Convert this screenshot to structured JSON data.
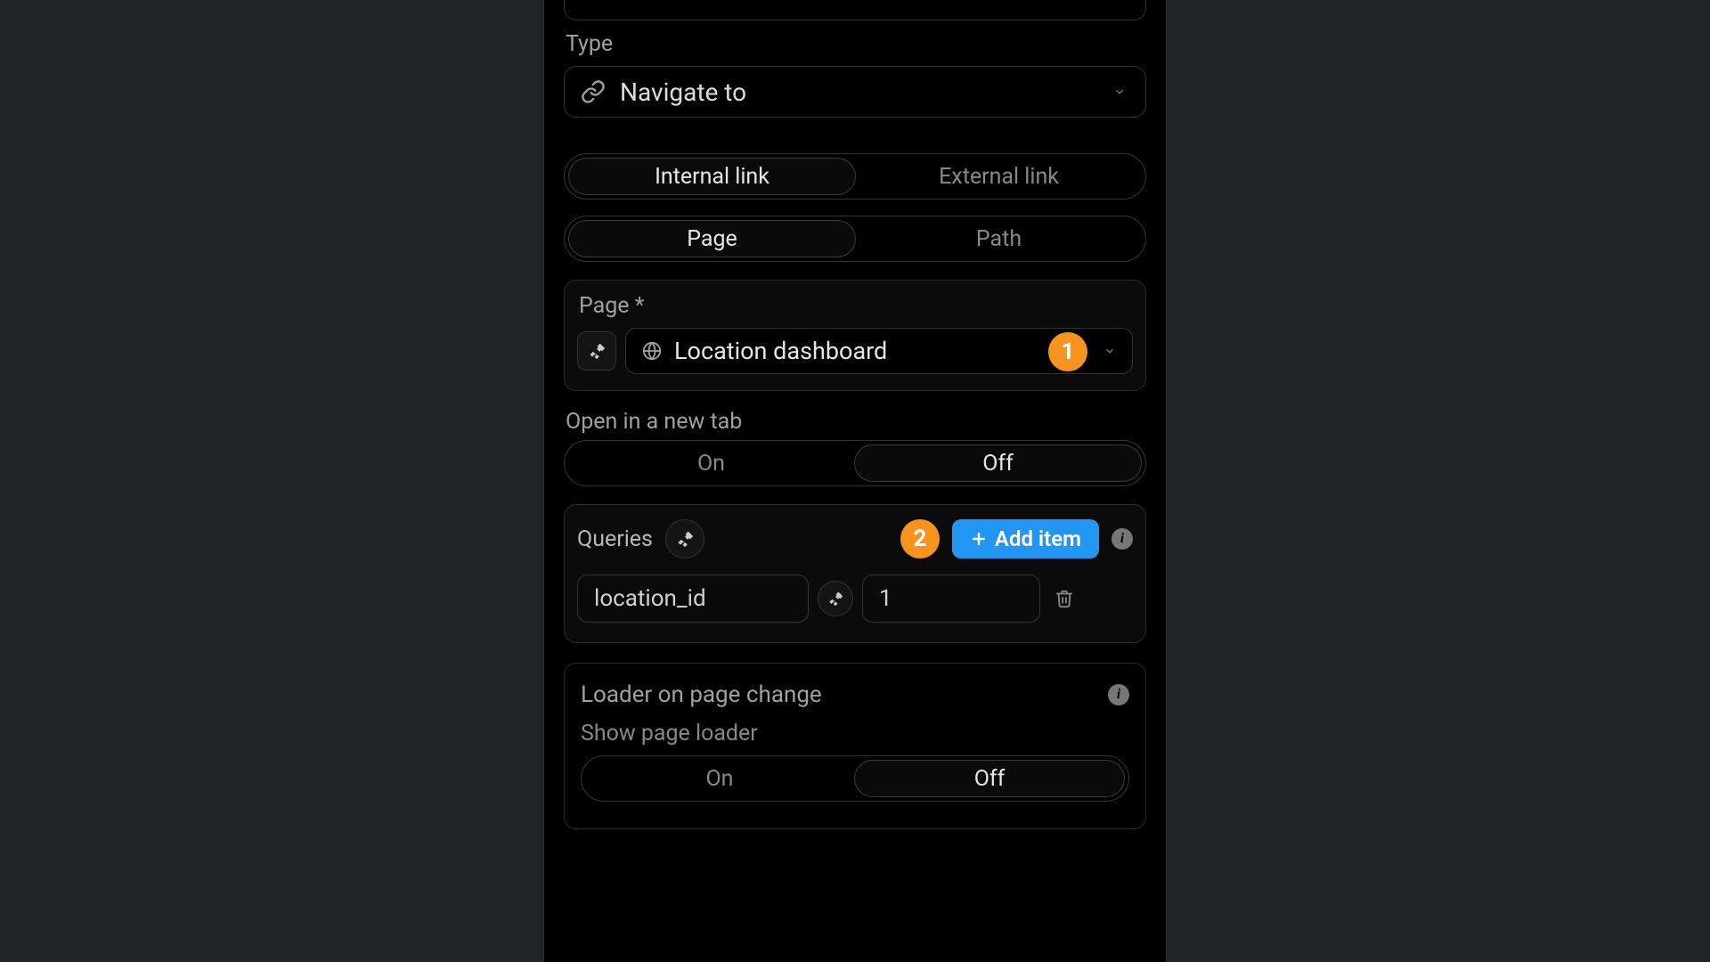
{
  "type": {
    "label": "Type",
    "value": "Navigate to"
  },
  "link_kind": {
    "options": [
      "Internal link",
      "External link"
    ],
    "active": 0
  },
  "target_mode": {
    "options": [
      "Page",
      "Path"
    ],
    "active": 0
  },
  "page_field": {
    "label": "Page",
    "value": "Location dashboard"
  },
  "open_new_tab": {
    "label": "Open in a new tab",
    "options": [
      "On",
      "Off"
    ],
    "active": 1
  },
  "queries": {
    "label": "Queries",
    "add_label": "Add item",
    "items": [
      {
        "key": "location_id",
        "value": "1"
      }
    ]
  },
  "loader": {
    "title": "Loader on page change",
    "sub": "Show page loader",
    "options": [
      "On",
      "Off"
    ],
    "active": 1
  },
  "annotations": {
    "badge1": "1",
    "badge2": "2"
  },
  "colors": {
    "accent_orange": "#f7941d",
    "accent_blue": "#2196f3"
  }
}
